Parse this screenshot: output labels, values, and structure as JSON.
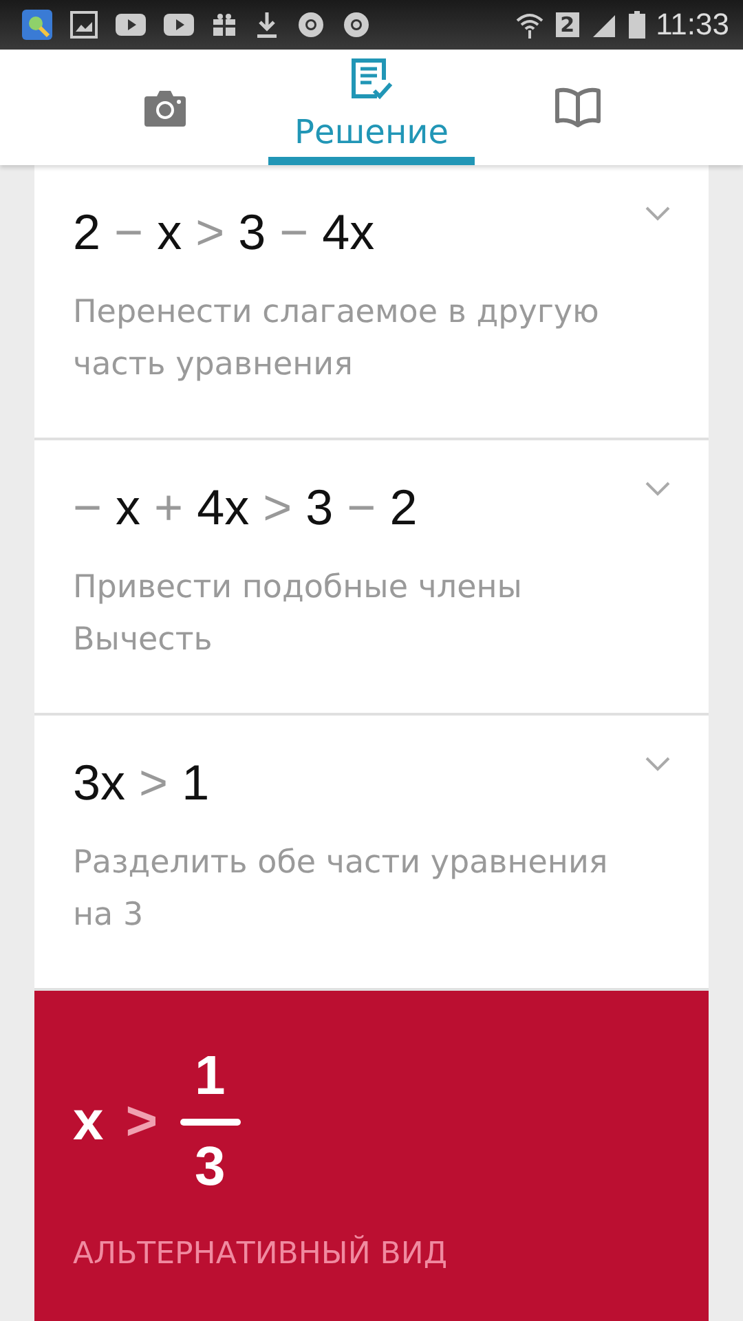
{
  "status_bar": {
    "time": "11:33",
    "sim": "2"
  },
  "tabs": [
    {
      "kind": "camera",
      "selected": false
    },
    {
      "kind": "solution",
      "label": "Решение",
      "selected": true
    },
    {
      "kind": "book",
      "selected": false
    }
  ],
  "steps": [
    {
      "expanded": false,
      "equation": [
        {
          "kind": "term",
          "text": "2"
        },
        {
          "kind": "op",
          "text": "−"
        },
        {
          "kind": "term",
          "text": "x"
        },
        {
          "kind": "op",
          "text": ">"
        },
        {
          "kind": "term",
          "text": "3"
        },
        {
          "kind": "op",
          "text": "−"
        },
        {
          "kind": "term",
          "text": "4x"
        }
      ],
      "description": [
        "Перенести слагаемое в другую",
        "часть уравнения"
      ]
    },
    {
      "expanded": false,
      "equation": [
        {
          "kind": "op",
          "text": "−"
        },
        {
          "kind": "term",
          "text": "x"
        },
        {
          "kind": "op",
          "text": "+"
        },
        {
          "kind": "term",
          "text": "4x"
        },
        {
          "kind": "op",
          "text": ">"
        },
        {
          "kind": "term",
          "text": "3"
        },
        {
          "kind": "op",
          "text": "−"
        },
        {
          "kind": "term",
          "text": "2"
        }
      ],
      "description": [
        "Привести подобные члены",
        "Вычесть"
      ]
    },
    {
      "expanded": false,
      "equation": [
        {
          "kind": "term",
          "text": "3x"
        },
        {
          "kind": "op",
          "text": ">"
        },
        {
          "kind": "term",
          "text": "1"
        }
      ],
      "description": [
        "Разделить обе части уравнения",
        "на 3"
      ]
    }
  ],
  "result": {
    "equation": [
      {
        "kind": "term",
        "text": "x"
      },
      {
        "kind": "op",
        "text": ">"
      },
      {
        "kind": "fraction",
        "numerator": "1",
        "denominator": "3"
      }
    ],
    "alternative_label": "АЛЬТЕРНАТИВНЫЙ ВИД"
  }
}
